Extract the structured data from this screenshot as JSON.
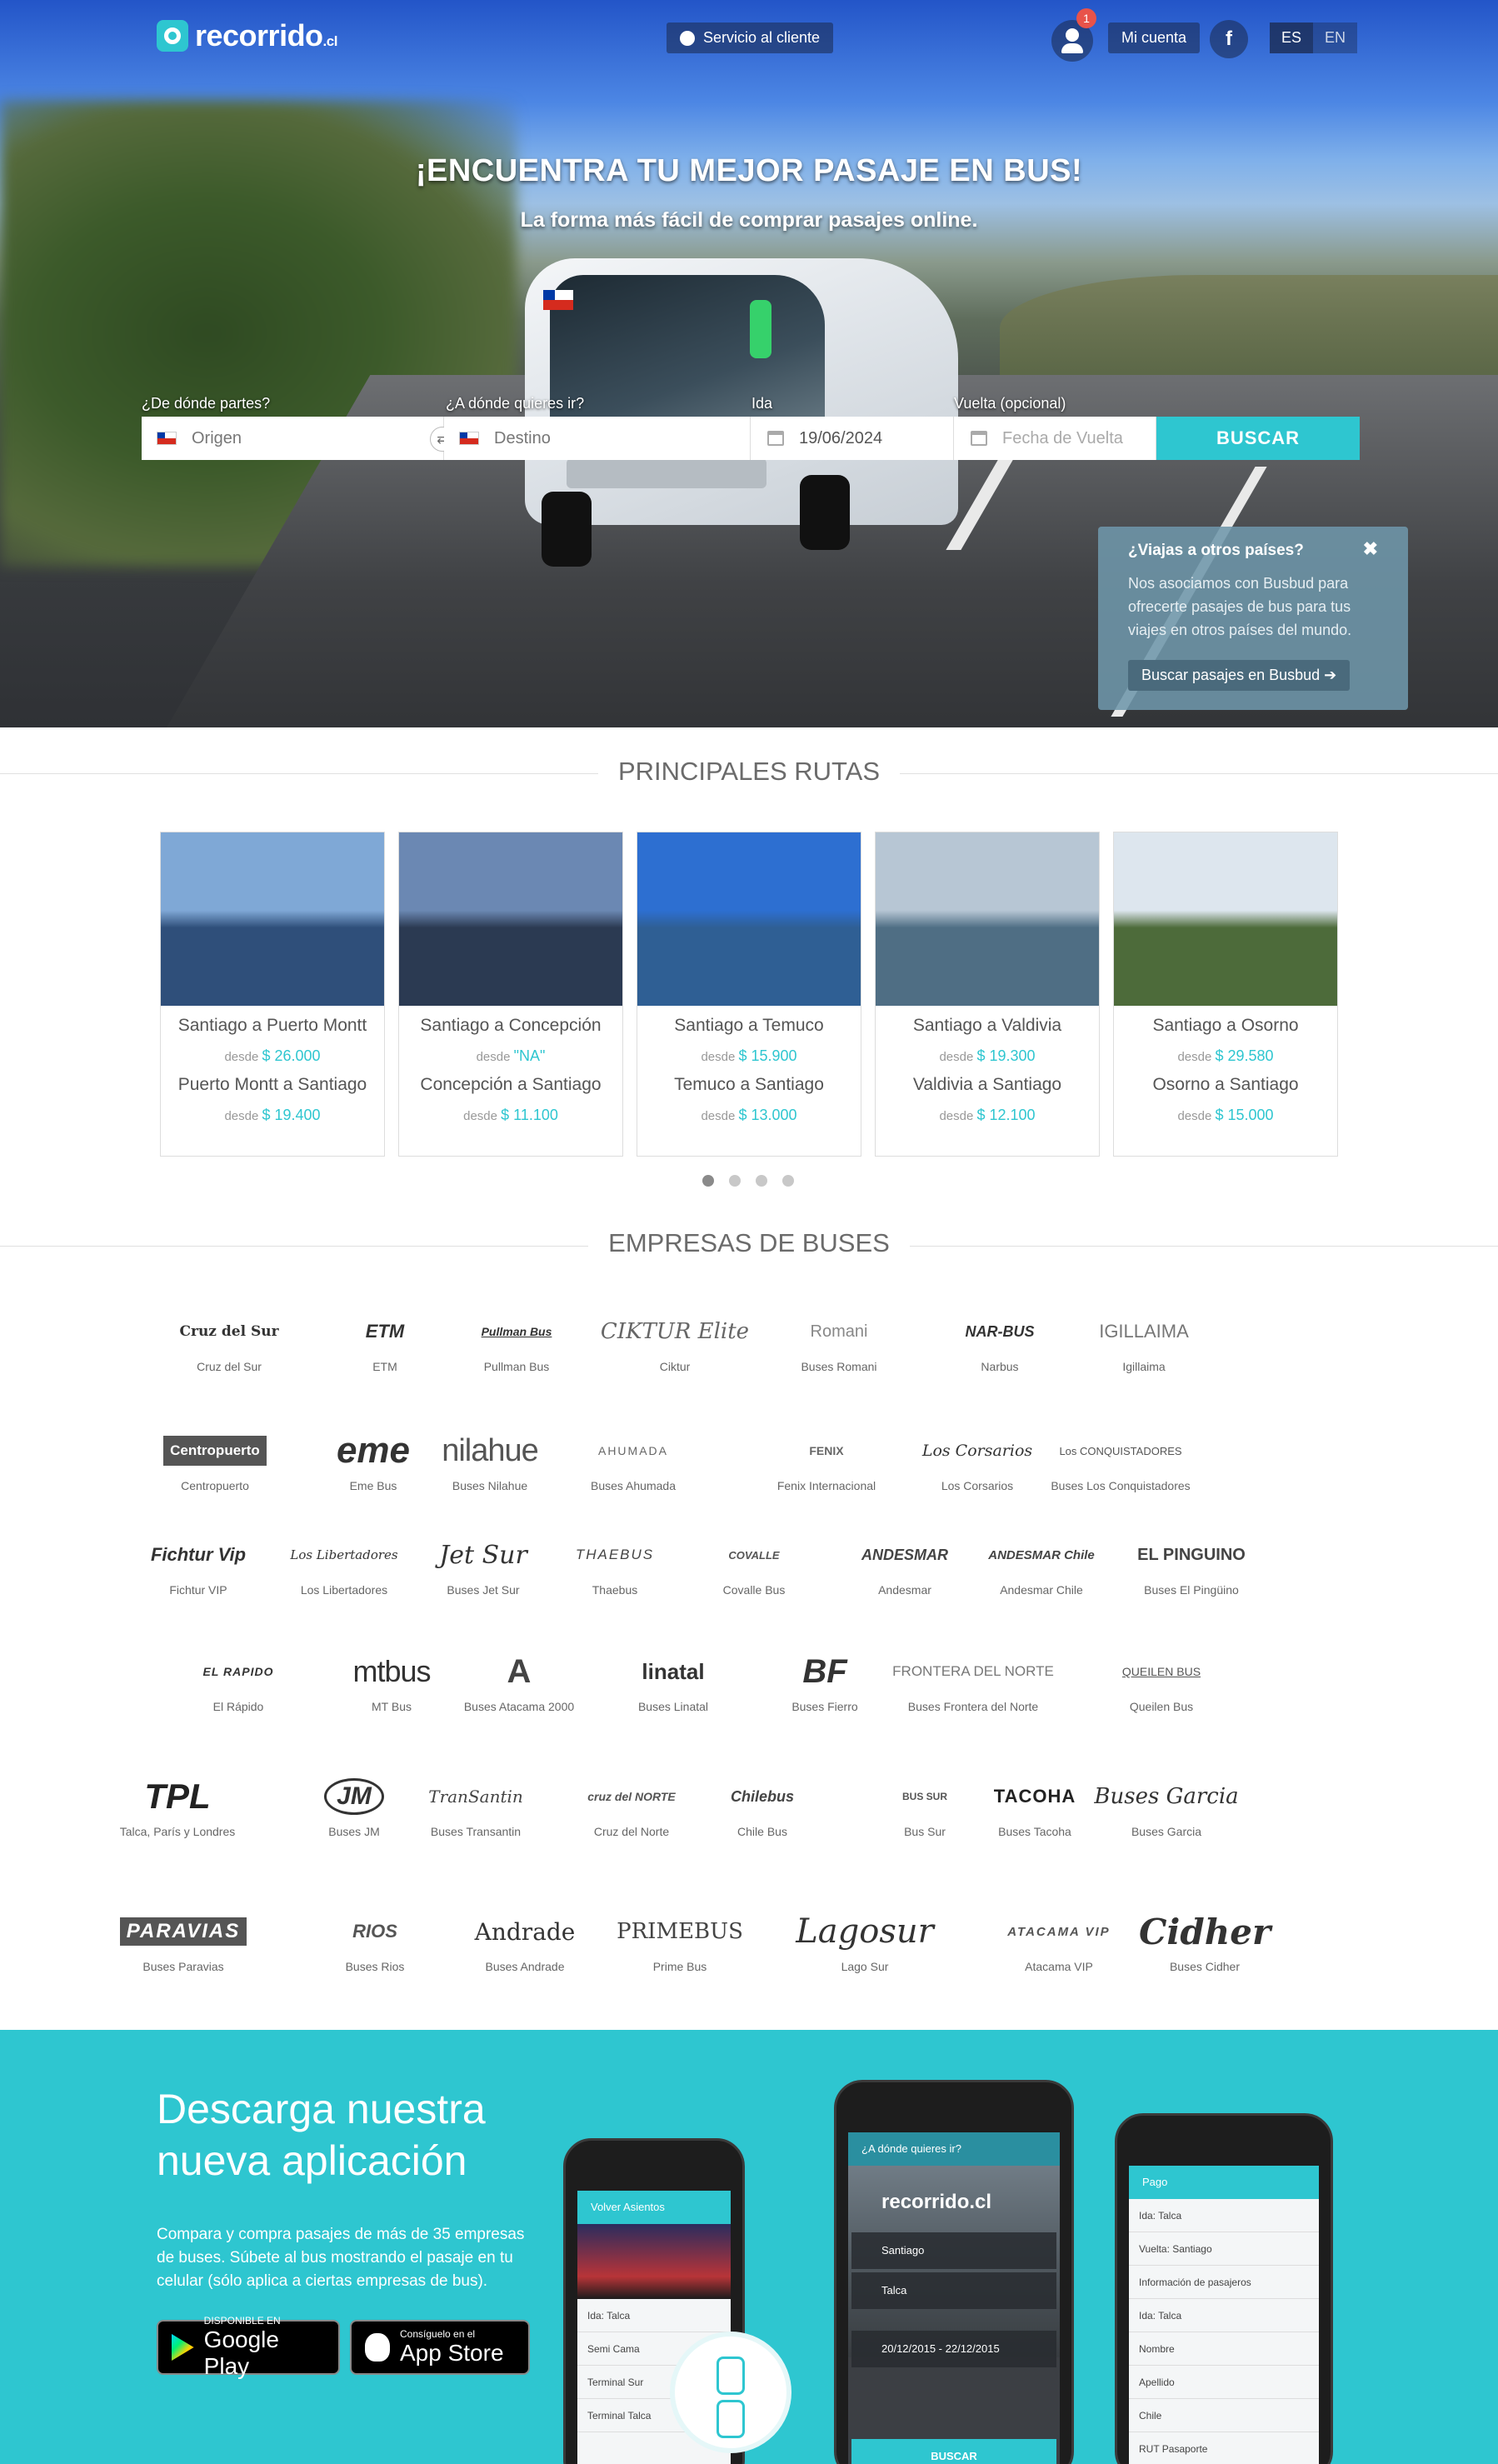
{
  "header": {
    "logo_text": "recorrido",
    "logo_tld": ".cl",
    "service_label": "Servicio al cliente",
    "notification_count": "1",
    "account_label": "Mi cuenta",
    "facebook_letter": "f",
    "lang_es": "ES",
    "lang_en": "EN"
  },
  "hero": {
    "title": "¡ENCUENTRA TU MEJOR PASAJE EN BUS!",
    "subtitle": "La forma más fácil de comprar pasajes online."
  },
  "search": {
    "origin_label": "¿De dónde partes?",
    "origin_placeholder": "Origen",
    "destination_label": "¿A dónde quieres ir?",
    "destination_placeholder": "Destino",
    "depart_label": "Ida",
    "depart_value": "19/06/2024",
    "return_label": "Vuelta (opcional)",
    "return_placeholder": "Fecha de Vuelta",
    "button_label": "BUSCAR"
  },
  "busbud": {
    "question": "¿Viajas a otros países?",
    "close": "✖",
    "text": "Nos asociamos con Busbud para ofrecerte pasajes de bus para tus viajes en otros países del mundo.",
    "button_label": "Buscar pasajes en Busbud ➔"
  },
  "routes_section": {
    "title": "PRINCIPALES RUTAS",
    "desde": "desde",
    "cards": [
      {
        "route1": "Santiago a Puerto Montt",
        "price1": "$ 26.000",
        "route2": "Puerto Montt a Santiago",
        "price2": "$ 19.400",
        "photo_sky": "#7fa8d6",
        "photo_ground": "#2f4f7a"
      },
      {
        "route1": "Santiago a Concepción",
        "price1": "\"NA\"",
        "route2": "Concepción a Santiago",
        "price2": "$ 11.100",
        "photo_sky": "#6b88b3",
        "photo_ground": "#2b3a52"
      },
      {
        "route1": "Santiago a Temuco",
        "price1": "$ 15.900",
        "route2": "Temuco a Santiago",
        "price2": "$ 13.000",
        "photo_sky": "#2d6fd1",
        "photo_ground": "#2f5f94"
      },
      {
        "route1": "Santiago a Valdivia",
        "price1": "$ 19.300",
        "route2": "Valdivia a Santiago",
        "price2": "$ 12.100",
        "photo_sky": "#b7c6d4",
        "photo_ground": "#4f6e84"
      },
      {
        "route1": "Santiago a Osorno",
        "price1": "$ 29.580",
        "route2": "Osorno a Santiago",
        "price2": "$ 15.000",
        "photo_sky": "#dde6ee",
        "photo_ground": "#4d6b3a"
      }
    ]
  },
  "companies_section": {
    "title": "EMPRESAS DE BUSES",
    "rows": [
      [
        {
          "mark": "Cruz del Sur",
          "name": "Cruz del Sur"
        },
        {
          "mark": "ETM",
          "name": "ETM"
        },
        {
          "mark": "Pullman Bus",
          "name": "Pullman Bus"
        },
        {
          "mark": "CIKTUR Elite",
          "name": "Ciktur"
        },
        {
          "mark": "Romani",
          "name": "Buses Romani"
        },
        {
          "mark": "NAR-BUS",
          "name": "Narbus"
        },
        {
          "mark": "IGILLAIMA",
          "name": "Igillaima"
        }
      ],
      [
        {
          "mark": "Centropuerto",
          "name": "Centropuerto"
        },
        {
          "mark": "eme",
          "name": "Eme Bus"
        },
        {
          "mark": "nilahue",
          "name": "Buses Nilahue"
        },
        {
          "mark": "AHUMADA",
          "name": "Buses Ahumada"
        },
        {
          "mark": "FENIX",
          "name": "Fenix Internacional"
        },
        {
          "mark": "Los Corsarios",
          "name": "Los Corsarios"
        },
        {
          "mark": "Los CONQUISTADORES",
          "name": "Buses Los Conquistadores"
        }
      ],
      [
        {
          "mark": "Fichtur Vip",
          "name": "Fichtur VIP"
        },
        {
          "mark": "Los Libertadores",
          "name": "Los Libertadores"
        },
        {
          "mark": "Jet Sur",
          "name": "Buses Jet Sur"
        },
        {
          "mark": "THAEBUS",
          "name": "Thaebus"
        },
        {
          "mark": "COVALLE",
          "name": "Covalle Bus"
        },
        {
          "mark": "ANDESMAR",
          "name": "Andesmar"
        },
        {
          "mark": "ANDESMAR Chile",
          "name": "Andesmar Chile"
        },
        {
          "mark": "EL PINGUINO",
          "name": "Buses El Pingüino"
        }
      ],
      [
        {
          "mark": "EL RAPIDO",
          "name": "El Rápido"
        },
        {
          "mark": "mtbus",
          "name": "MT Bus"
        },
        {
          "mark": "A",
          "name": "Buses Atacama 2000"
        },
        {
          "mark": "linatal",
          "name": "Buses Linatal"
        },
        {
          "mark": "BF",
          "name": "Buses Fierro"
        },
        {
          "mark": "FRONTERA DEL NORTE",
          "name": "Buses Frontera del Norte"
        },
        {
          "mark": "QUEILEN BUS",
          "name": "Queilen Bus"
        }
      ],
      [
        {
          "mark": "TPL",
          "name": "Talca, París y Londres"
        },
        {
          "mark": "JM",
          "name": "Buses JM"
        },
        {
          "mark": "TranSantin",
          "name": "Buses Transantin"
        },
        {
          "mark": "cruz del NORTE",
          "name": "Cruz del Norte"
        },
        {
          "mark": "Chilebus",
          "name": "Chile Bus"
        },
        {
          "mark": "BUS SUR",
          "name": "Bus Sur"
        },
        {
          "mark": "TACOHA",
          "name": "Buses Tacoha"
        },
        {
          "mark": "Buses Garcia",
          "name": "Buses Garcia"
        }
      ],
      [
        {
          "mark": "PARAVIAS",
          "name": "Buses Paravias"
        },
        {
          "mark": "RIOS",
          "name": "Buses Rios"
        },
        {
          "mark": "Andrade",
          "name": "Buses Andrade"
        },
        {
          "mark": "PRIMEBUS",
          "name": "Prime Bus"
        },
        {
          "mark": "Lagosur",
          "name": "Lago Sur"
        },
        {
          "mark": "ATACAMA VIP",
          "name": "Atacama VIP"
        },
        {
          "mark": "Cidher",
          "name": "Buses Cidher"
        }
      ]
    ]
  },
  "app_section": {
    "title": "Descarga nuestra nueva aplicación",
    "description": "Compara y compra pasajes de más de 35 empresas de buses. Súbete al bus mostrando el pasaje en tu celular (sólo aplica a ciertas empresas de bus).",
    "google_small": "DISPONIBLE EN",
    "google_big": "Google Play",
    "apple_small": "Consíguelo en el",
    "apple_big": "App Store",
    "phone1_bar": "Volver  Asientos",
    "phone1_rows": [
      "Ida: Talca",
      "Semi Cama",
      "Terminal Sur",
      "Terminal Talca"
    ],
    "phone2_bar": "¿A dónde quieres ir?",
    "phone2_logo": "recorrido.cl",
    "phone2_from": "Santiago",
    "phone2_to": "Talca",
    "phone2_dates": "20/12/2015 - 22/12/2015",
    "phone2_button": "BUSCAR",
    "phone3_bar": "Pago",
    "phone3_rows": [
      "Ida: Talca",
      "Vuelta: Santiago",
      "Información de pasajeros",
      "Ida: Talca",
      "Nombre",
      "Apellido",
      "Chile",
      "RUT   Pasaporte"
    ]
  }
}
